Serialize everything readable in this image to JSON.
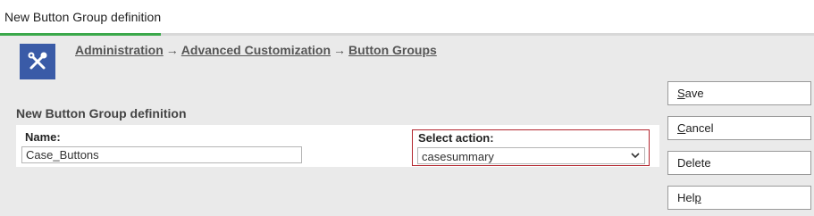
{
  "tab": {
    "title": "New Button Group definition"
  },
  "icon": {
    "name": "tools-icon",
    "bg_color": "#3a5ba7"
  },
  "breadcrumb": {
    "items": [
      "Administration",
      "Advanced Customization",
      "Button Groups"
    ],
    "separator": "→"
  },
  "section": {
    "title": "New Button Group definition"
  },
  "form": {
    "name_label": "Name:",
    "name_value": "Case_Buttons",
    "action_label": "Select action:",
    "action_value": "casesummary"
  },
  "buttons": {
    "save": {
      "first": "S",
      "rest": "ave"
    },
    "cancel": {
      "first": "C",
      "rest": "ancel"
    },
    "delete": {
      "label": "Delete"
    },
    "help": {
      "first": "Hel",
      "mid": "p",
      "rest": ""
    }
  },
  "colors": {
    "tab_accent": "#3aa84a",
    "highlight_border": "#b3262f"
  }
}
